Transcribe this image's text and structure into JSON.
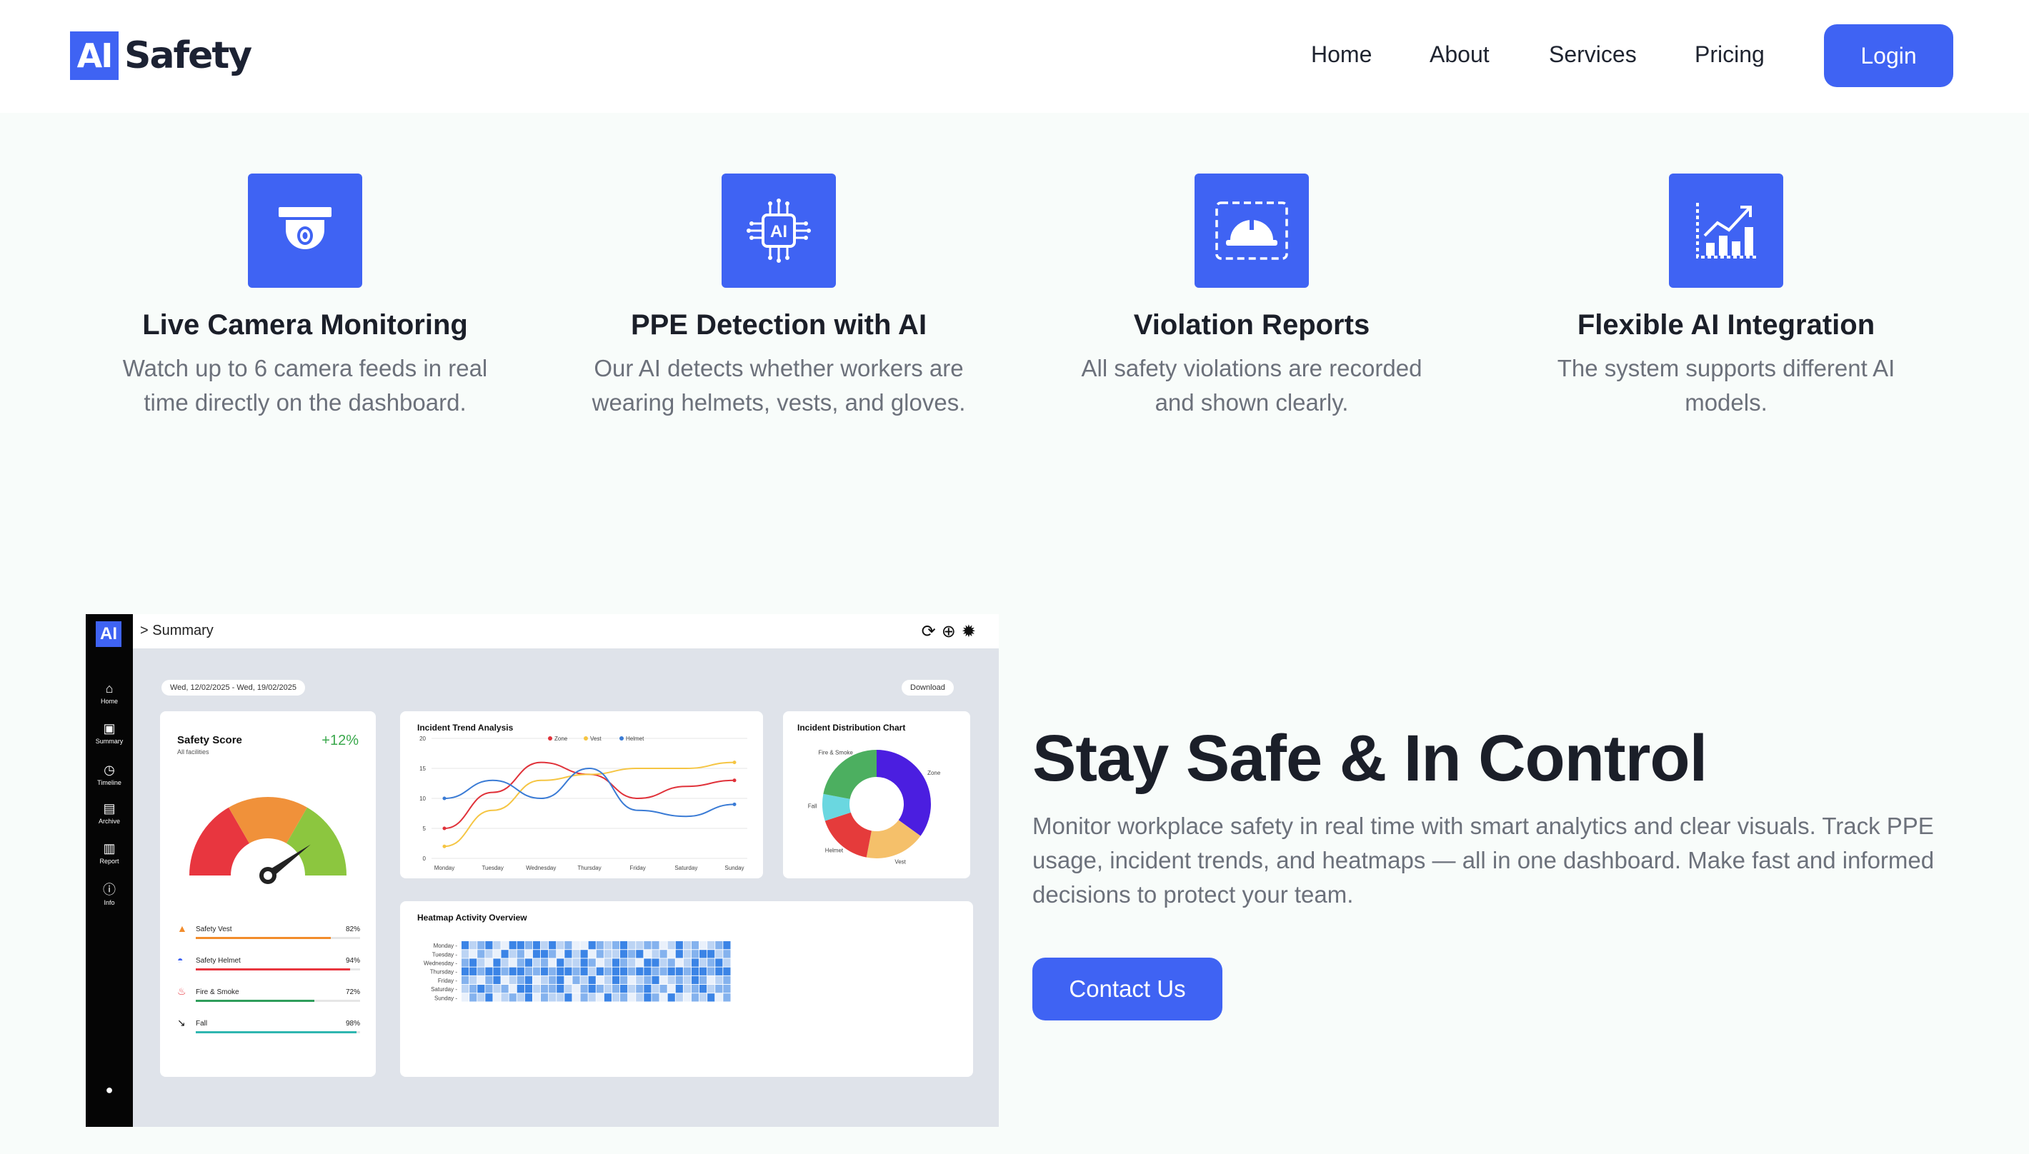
{
  "brand": {
    "logo_mark": "AI",
    "logo_word": "Safety"
  },
  "nav": {
    "links": [
      "Home",
      "About",
      "Services",
      "Pricing"
    ],
    "login_label": "Login"
  },
  "colors": {
    "accent": "#3f63f3",
    "text_dark": "#1b1f29",
    "text_muted": "#6c717b",
    "section_bg": "#f8fcfa"
  },
  "features": [
    {
      "icon": "security-camera-icon",
      "title": "Live Camera Monitoring",
      "desc": "Watch up to 6 camera feeds in real time directly on the dashboard."
    },
    {
      "icon": "ai-chip-icon",
      "title": "PPE Detection with AI",
      "desc": "Our AI detects whether workers are wearing helmets, vests, and gloves."
    },
    {
      "icon": "hard-hat-detection-icon",
      "title": "Violation Reports",
      "desc": "All safety violations are recorded and shown clearly."
    },
    {
      "icon": "growth-chart-icon",
      "title": "Flexible AI Integration",
      "desc": "The system supports different AI models."
    }
  ],
  "dashboard": {
    "logo_mark": "AI",
    "breadcrumb": "> Summary",
    "sidebar": [
      {
        "icon": "home-icon",
        "label": "Home"
      },
      {
        "icon": "summary-icon",
        "label": "Summary"
      },
      {
        "icon": "clock-icon",
        "label": "Timeline"
      },
      {
        "icon": "archive-icon",
        "label": "Archive"
      },
      {
        "icon": "report-icon",
        "label": "Report"
      },
      {
        "icon": "info-icon",
        "label": "Info"
      }
    ],
    "date_range": "Wed, 12/02/2025 - Wed, 19/02/2025",
    "download_label": "Download",
    "safety_score": {
      "title": "Safety Score",
      "subtitle": "All facilities",
      "delta": "+12%",
      "items": [
        {
          "name": "Safety Vest",
          "value": "82%",
          "pct": 82,
          "color": "#f28c2b",
          "icon": "vest-icon"
        },
        {
          "name": "Safety Helmet",
          "value": "94%",
          "pct": 94,
          "color": "#e8363f",
          "icon": "helmet-icon"
        },
        {
          "name": "Fire & Smoke",
          "value": "72%",
          "pct": 72,
          "color": "#2f9e5b",
          "icon": "fire-icon"
        },
        {
          "name": "Fall",
          "value": "98%",
          "pct": 98,
          "color": "#2fb6b0",
          "icon": "fall-icon"
        }
      ]
    },
    "trend": {
      "title": "Incident Trend Analysis",
      "legend": [
        "Zone",
        "Vest",
        "Helmet"
      ]
    },
    "distribution": {
      "title": "Incident Distribution Chart",
      "labels": [
        "Fire & Smoke",
        "Zone",
        "Fall",
        "Helmet",
        "Vest"
      ]
    },
    "heatmap": {
      "title": "Heatmap Activity Overview"
    }
  },
  "chart_data": [
    {
      "type": "line",
      "title": "Incident Trend Analysis",
      "categories": [
        "Monday",
        "Tuesday",
        "Wednesday",
        "Thursday",
        "Friday",
        "Saturday",
        "Sunday"
      ],
      "ylim": [
        0,
        20
      ],
      "yticks": [
        0,
        5,
        10,
        15,
        20
      ],
      "series": [
        {
          "name": "Zone",
          "color": "#e0323a",
          "values": [
            5,
            11,
            16,
            14,
            10,
            12,
            13
          ]
        },
        {
          "name": "Vest",
          "color": "#f5c543",
          "values": [
            2,
            8,
            13,
            14,
            15,
            15,
            16
          ]
        },
        {
          "name": "Helmet",
          "color": "#3a7bd5",
          "values": [
            10,
            13,
            10,
            15,
            8,
            7,
            9
          ]
        }
      ]
    },
    {
      "type": "pie",
      "title": "Incident Distribution Chart",
      "slices": [
        {
          "label": "Zone",
          "value": 35,
          "color": "#4b1ee0"
        },
        {
          "label": "Vest",
          "value": 18,
          "color": "#f5c06a"
        },
        {
          "label": "Helmet",
          "value": 17,
          "color": "#e53b3b"
        },
        {
          "label": "Fall",
          "value": 8,
          "color": "#6ad7e0"
        },
        {
          "label": "Fire & Smoke",
          "value": 22,
          "color": "#4caf60"
        }
      ]
    },
    {
      "type": "heatmap",
      "title": "Heatmap Activity Overview",
      "rows": [
        "Monday",
        "Tuesday",
        "Wednesday",
        "Thursday",
        "Friday",
        "Saturday",
        "Sunday"
      ],
      "columns": 34,
      "levels": 4,
      "values": [
        [
          3,
          1,
          2,
          3,
          1,
          0,
          3,
          3,
          2,
          3,
          1,
          3,
          1,
          2,
          0,
          0,
          3,
          2,
          1,
          2,
          3,
          1,
          1,
          2,
          2,
          0,
          1,
          3,
          1,
          2,
          0,
          1,
          2,
          3
        ],
        [
          1,
          0,
          2,
          1,
          0,
          3,
          1,
          2,
          0,
          3,
          3,
          2,
          0,
          3,
          1,
          3,
          0,
          2,
          1,
          1,
          3,
          2,
          3,
          0,
          1,
          2,
          0,
          3,
          1,
          2,
          3,
          3,
          1,
          2
        ],
        [
          2,
          3,
          1,
          0,
          3,
          1,
          0,
          2,
          3,
          1,
          2,
          0,
          3,
          1,
          1,
          3,
          2,
          0,
          1,
          3,
          2,
          1,
          0,
          3,
          3,
          1,
          2,
          0,
          1,
          3,
          1,
          2,
          3,
          1
        ],
        [
          3,
          3,
          2,
          3,
          3,
          2,
          3,
          3,
          2,
          2,
          3,
          2,
          3,
          3,
          2,
          3,
          1,
          3,
          2,
          3,
          3,
          2,
          3,
          3,
          2,
          2,
          3,
          3,
          2,
          3,
          3,
          2,
          3,
          3
        ],
        [
          2,
          1,
          0,
          2,
          3,
          0,
          1,
          2,
          3,
          0,
          1,
          2,
          3,
          0,
          2,
          1,
          3,
          0,
          1,
          3,
          2,
          0,
          1,
          2,
          3,
          0,
          1,
          2,
          1,
          3,
          2,
          0,
          1,
          2
        ],
        [
          1,
          2,
          3,
          2,
          1,
          2,
          0,
          3,
          3,
          1,
          2,
          2,
          3,
          1,
          0,
          2,
          3,
          2,
          1,
          2,
          3,
          1,
          2,
          3,
          1,
          2,
          0,
          3,
          1,
          2,
          3,
          1,
          2,
          2
        ],
        [
          0,
          2,
          1,
          3,
          0,
          1,
          2,
          1,
          3,
          0,
          2,
          1,
          1,
          3,
          0,
          2,
          1,
          0,
          3,
          1,
          2,
          0,
          1,
          3,
          2,
          0,
          3,
          1,
          0,
          2,
          1,
          3,
          0,
          2
        ]
      ]
    },
    {
      "type": "gauge",
      "title": "Safety Score",
      "segments": [
        "#e8363f",
        "#f0913a",
        "#8cc63f"
      ],
      "needle_fraction": 0.8
    }
  ],
  "hero": {
    "title": "Stay Safe & In Control",
    "desc": "Monitor workplace safety in real time with smart analytics and clear visuals. Track PPE usage, incident trends, and heatmaps — all in one dashboard. Make fast and informed decisions to protect your team.",
    "cta_label": "Contact Us"
  }
}
